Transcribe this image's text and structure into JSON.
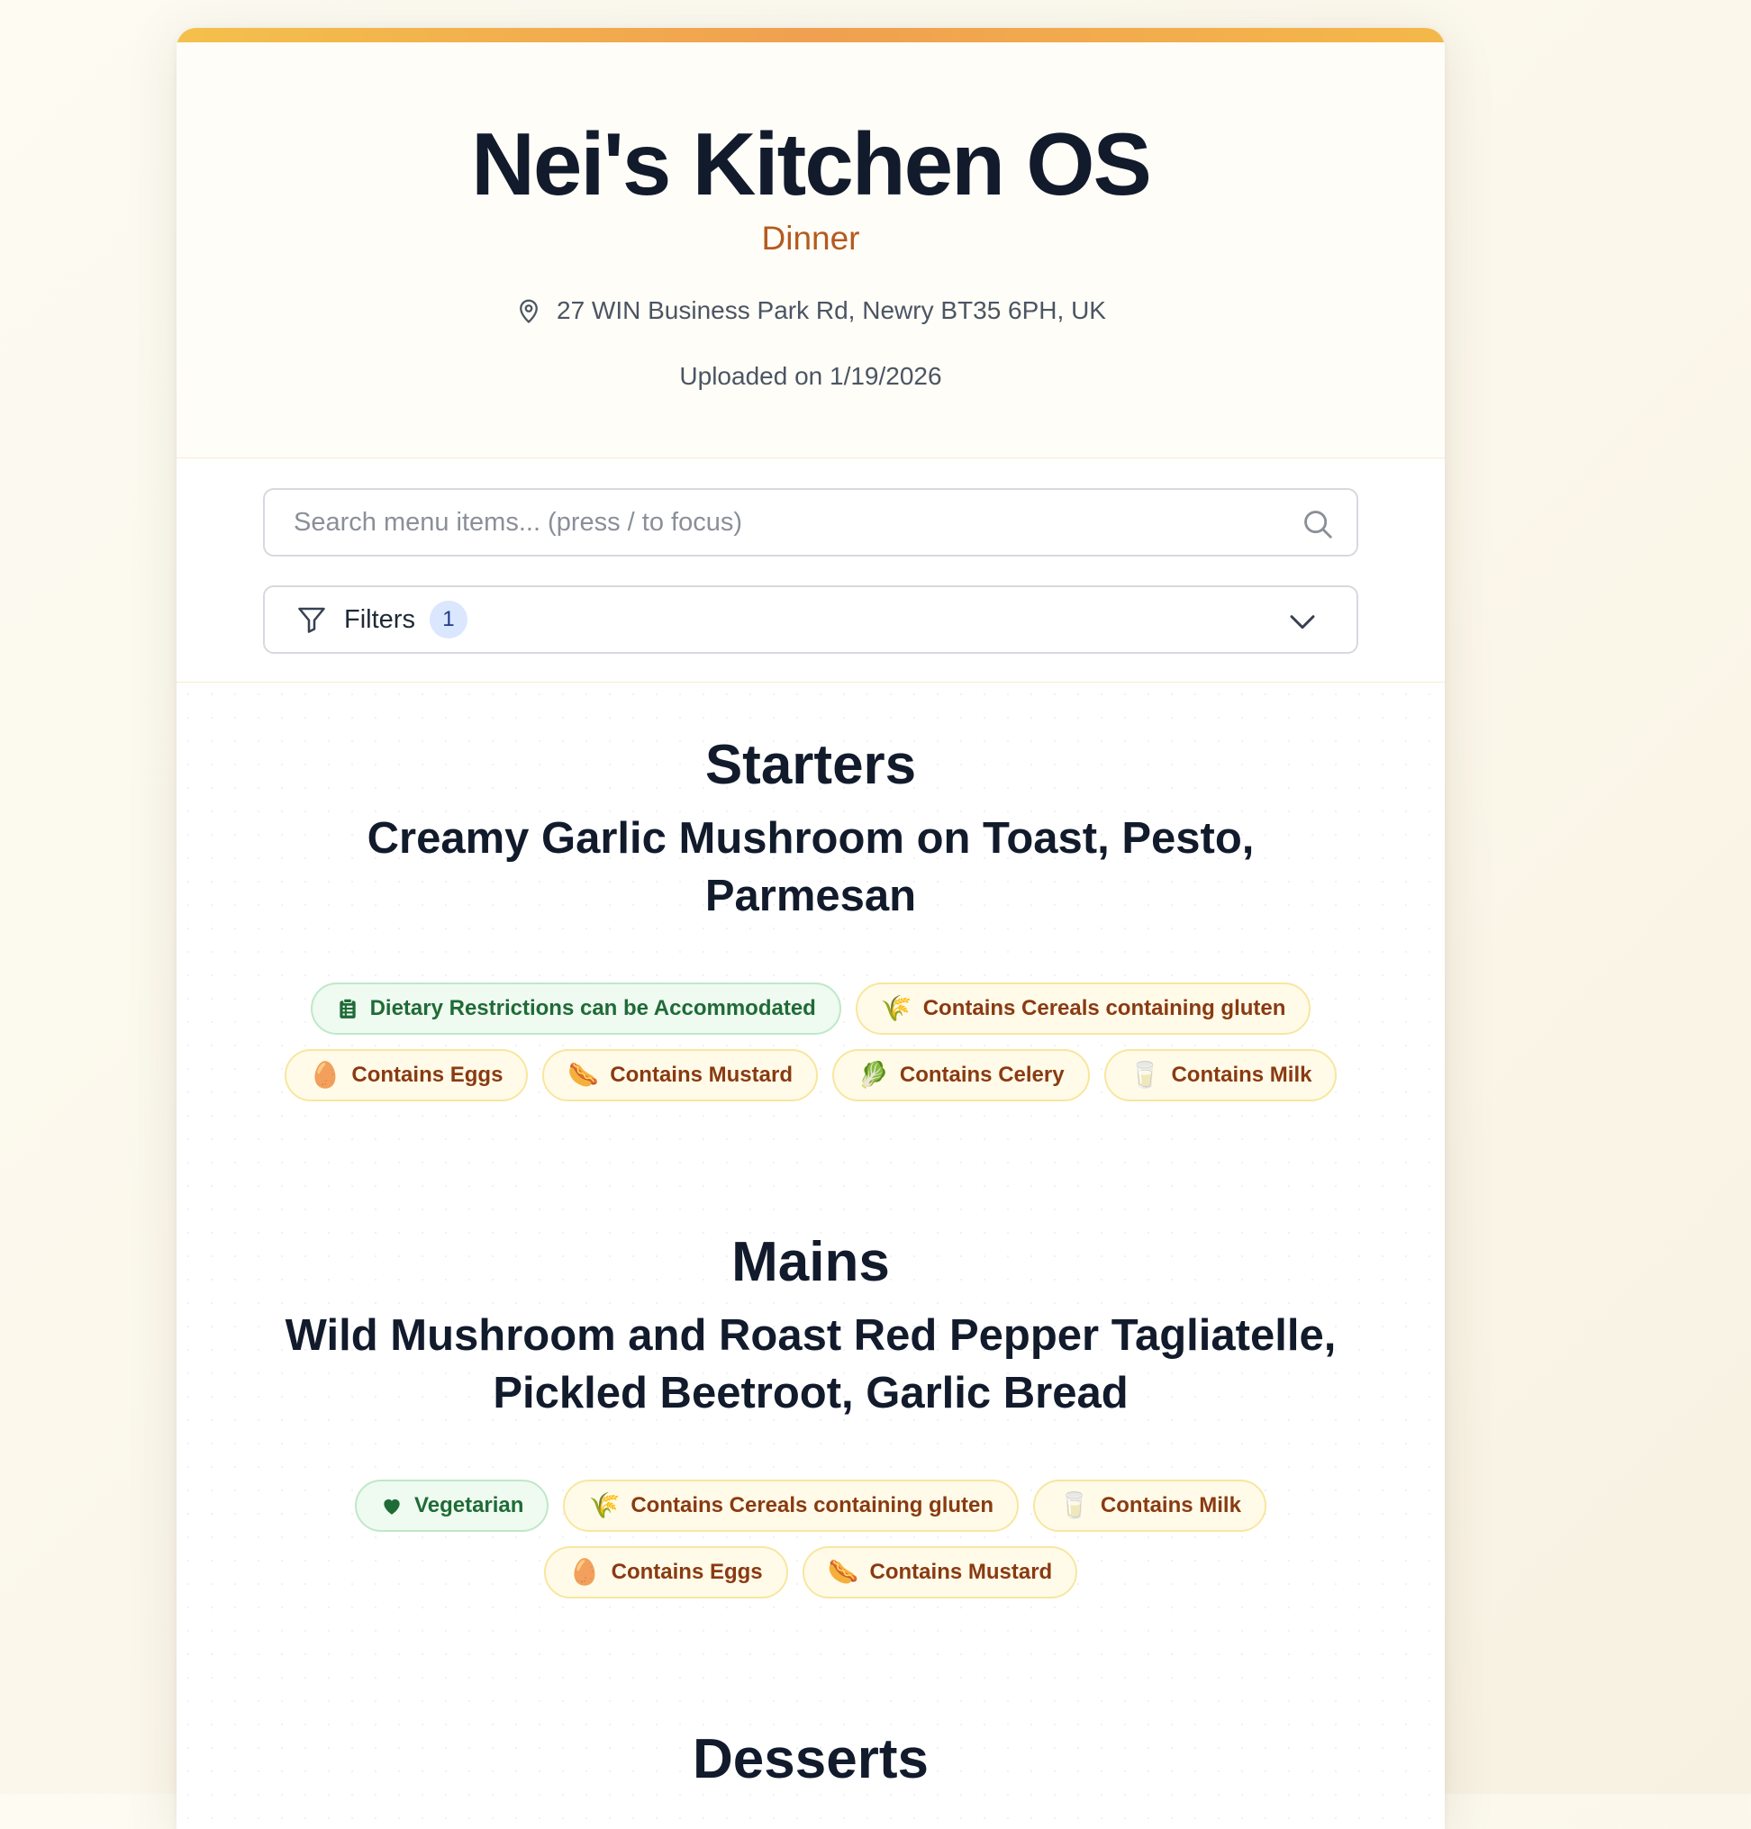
{
  "header": {
    "title": "Nei's Kitchen OS",
    "subtitle": "Dinner",
    "address": "27 WIN Business Park Rd, Newry BT35 6PH, UK",
    "uploaded": "Uploaded on 1/19/2026"
  },
  "search": {
    "placeholder": "Search menu items... (press / to focus)",
    "value": ""
  },
  "filters": {
    "label": "Filters",
    "count": "1"
  },
  "sections": [
    {
      "title": "Starters",
      "items": [
        {
          "name": "Creamy Garlic Mushroom on Toast, Pesto, Parmesan",
          "tags": [
            {
              "label": "Dietary Restrictions can be Accommodated",
              "kind": "diet",
              "icon": "clipboard-icon"
            },
            {
              "label": "Contains Cereals containing gluten",
              "kind": "allergen",
              "icon": "wheat-icon",
              "glyph": "🌾"
            },
            {
              "label": "Contains Eggs",
              "kind": "allergen",
              "icon": "egg-icon",
              "glyph": "🥚"
            },
            {
              "label": "Contains Mustard",
              "kind": "allergen",
              "icon": "hotdog-icon",
              "glyph": "🌭"
            },
            {
              "label": "Contains Celery",
              "kind": "allergen",
              "icon": "leafy-green-icon",
              "glyph": "🥬"
            },
            {
              "label": "Contains Milk",
              "kind": "allergen",
              "icon": "milk-glass-icon",
              "glyph": "🥛"
            }
          ]
        }
      ]
    },
    {
      "title": "Mains",
      "items": [
        {
          "name": "Wild Mushroom and Roast Red Pepper Tagliatelle, Pickled Beetroot, Garlic Bread",
          "tags": [
            {
              "label": "Vegetarian",
              "kind": "diet",
              "icon": "heart-icon"
            },
            {
              "label": "Contains Cereals containing gluten",
              "kind": "allergen",
              "icon": "wheat-icon",
              "glyph": "🌾"
            },
            {
              "label": "Contains Milk",
              "kind": "allergen",
              "icon": "milk-glass-icon",
              "glyph": "🥛"
            },
            {
              "label": "Contains Eggs",
              "kind": "allergen",
              "icon": "egg-icon",
              "glyph": "🥚"
            },
            {
              "label": "Contains Mustard",
              "kind": "allergen",
              "icon": "hotdog-icon",
              "glyph": "🌭"
            }
          ]
        }
      ]
    },
    {
      "title": "Desserts",
      "items": []
    }
  ],
  "colors": {
    "accent": "#b45a1f",
    "allergen_bg": "#fffbe8",
    "allergen_text": "#8a3a12",
    "diet_bg": "#effaf1",
    "diet_text": "#1f6b36",
    "badge_bg": "#dbe6ff"
  }
}
